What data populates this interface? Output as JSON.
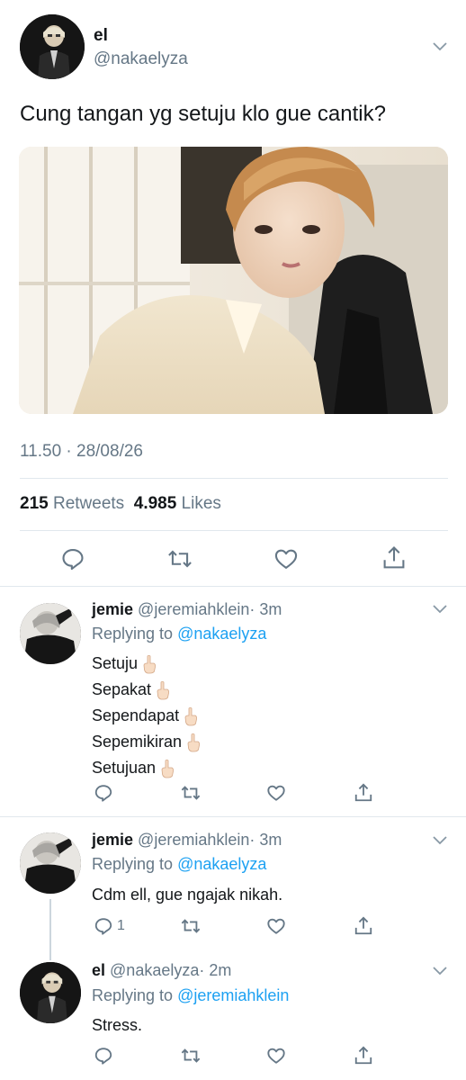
{
  "main_tweet": {
    "name": "el",
    "handle": "@nakaelyza",
    "text": "Cung tangan yg setuju klo gue cantik?",
    "timestamp": "11.50 · 28/08/26",
    "retweets": "215",
    "retweets_label": "Retweets",
    "likes": "4.985",
    "likes_label": "Likes"
  },
  "replies": [
    {
      "name": "jemie",
      "handle": "@jeremiahklein",
      "time": "· 3m",
      "replying_prefix": "Replying to",
      "replying_to": "@nakaelyza",
      "lines": [
        "Setuju",
        "Sepakat",
        "Sependapat",
        "Sepemikiran",
        "Setujuan"
      ],
      "reply_count": ""
    },
    {
      "name": "jemie",
      "handle": "@jeremiahklein",
      "time": "· 3m",
      "replying_prefix": "Replying to",
      "replying_to": "@nakaelyza",
      "lines": [
        "Cdm ell, gue ngajak nikah."
      ],
      "reply_count": "1"
    },
    {
      "name": "el",
      "handle": "@nakaelyza",
      "time": "· 2m",
      "replying_prefix": "Replying to",
      "replying_to": "@jeremiahklein",
      "lines": [
        "Stress."
      ],
      "reply_count": ""
    }
  ],
  "colors": {
    "text": "#14171a",
    "secondary": "#657786",
    "link": "#1da1f2",
    "divider": "#e1e8ed"
  },
  "icons": [
    "reply-icon",
    "retweet-icon",
    "like-icon",
    "share-icon",
    "chevron-down-icon",
    "pointing-up-hand-icon"
  ]
}
